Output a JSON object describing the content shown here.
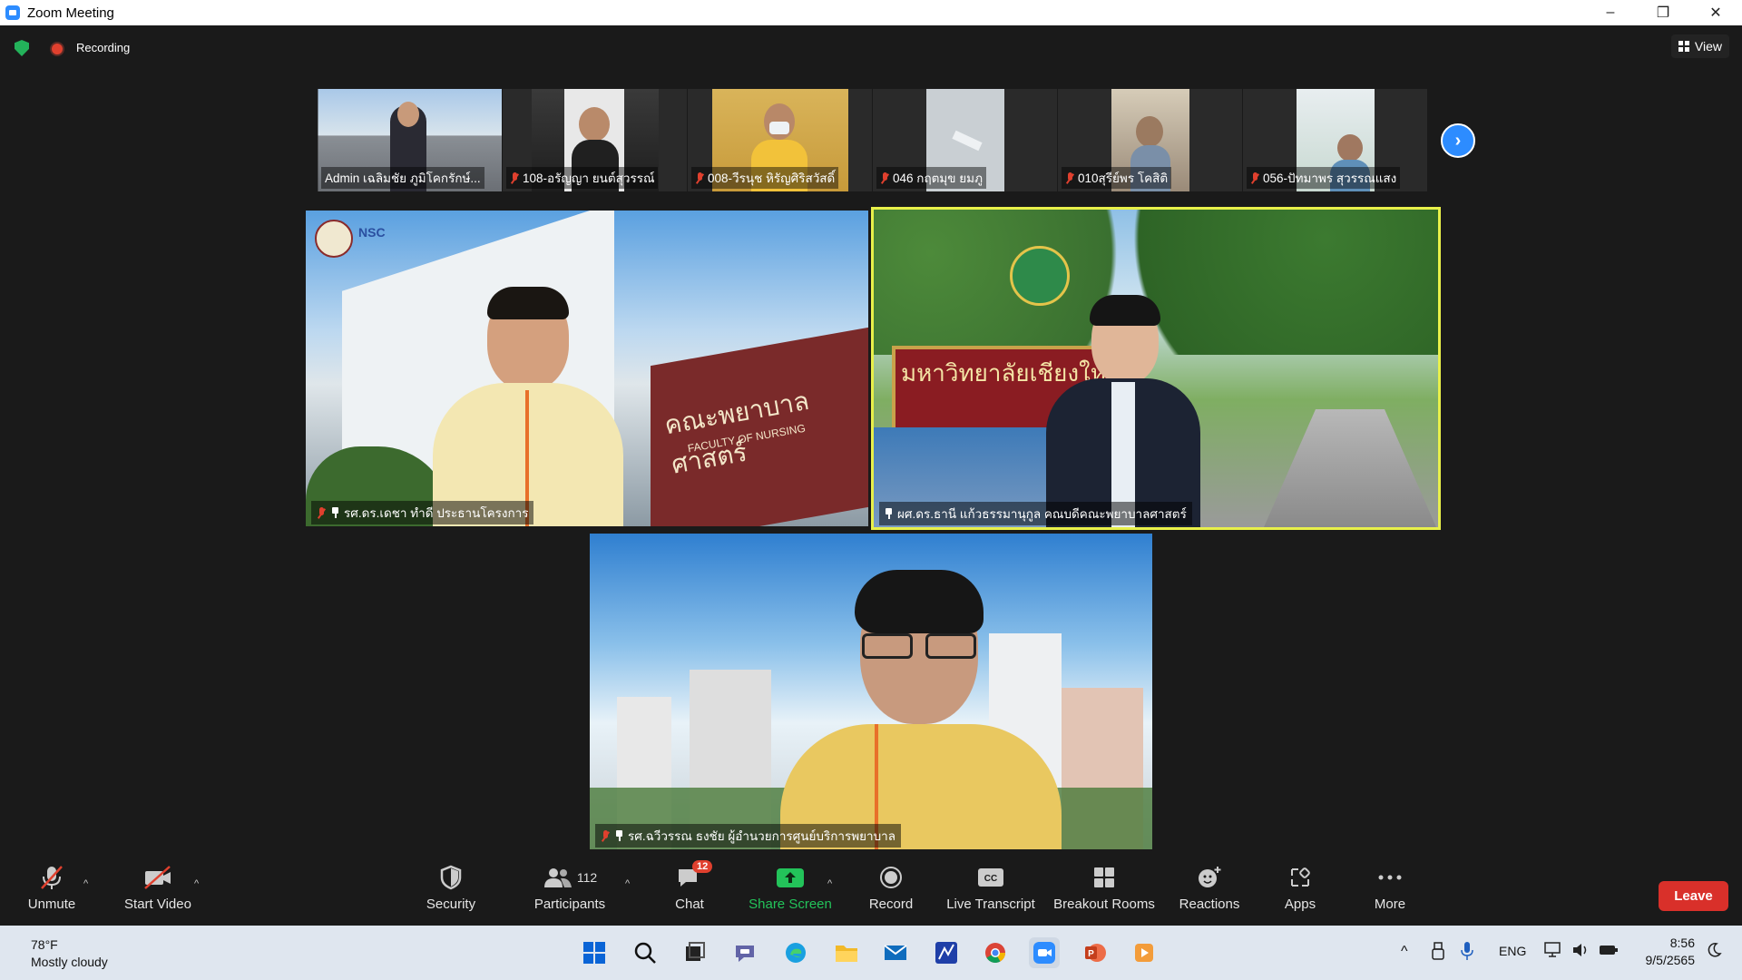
{
  "window": {
    "title": "Zoom Meeting",
    "controls": [
      "–",
      "❐",
      "✕"
    ]
  },
  "meeting_bar": {
    "recording_label": "Recording",
    "view_label": "View"
  },
  "thumbnails": [
    {
      "name": "Admin เฉลิมชัย  ภูมิโคกรักษ์...",
      "muted": false
    },
    {
      "name": "108-อรัญญา ยนต์สุวรรณ์",
      "muted": true
    },
    {
      "name": "008-วีรนุช หิรัญศิริสวัสดิ์",
      "muted": true
    },
    {
      "name": "046 กฤตมุข ยมภู",
      "muted": true
    },
    {
      "name": "010สุรีย์พร โคสิติ",
      "muted": true
    },
    {
      "name": "056-ปัทมาพร สุวรรณแสง",
      "muted": true
    }
  ],
  "tiles": {
    "left": {
      "name": "รศ.ดร.เดชา ทำดี ประธานโครงการ",
      "logo_text": "NSC",
      "sign_line1": "คณะพยาบาลศาสตร์",
      "sign_line2": "FACULTY OF NURSING"
    },
    "right": {
      "name": "ผศ.ดร.ธานี แก้วธรรมานุกูล คณบดีคณะพยาบาลศาสตร์",
      "sign_text": "มหาวิทยาลัยเชียงใหม่"
    },
    "bottom": {
      "name": "รศ.ฉวีวรรณ ธงชัย ผู้อำนวยการศูนย์บริการพยาบาล"
    }
  },
  "toolbar": {
    "unmute": "Unmute",
    "start_video": "Start Video",
    "security": "Security",
    "participants": "Participants",
    "participants_count": "112",
    "chat": "Chat",
    "chat_badge": "12",
    "share_screen": "Share Screen",
    "record": "Record",
    "live_transcript": "Live Transcript",
    "breakout_rooms": "Breakout Rooms",
    "reactions": "Reactions",
    "apps": "Apps",
    "more": "More",
    "leave": "Leave"
  },
  "taskbar": {
    "temperature": "78°F",
    "weather": "Mostly cloudy",
    "language": "ENG",
    "time": "8:56",
    "date": "9/5/2565"
  },
  "colors": {
    "accent": "#2d8cff",
    "leave": "#d9302a",
    "active_speaker": "#e8f04a",
    "share_green": "#23c35a"
  }
}
